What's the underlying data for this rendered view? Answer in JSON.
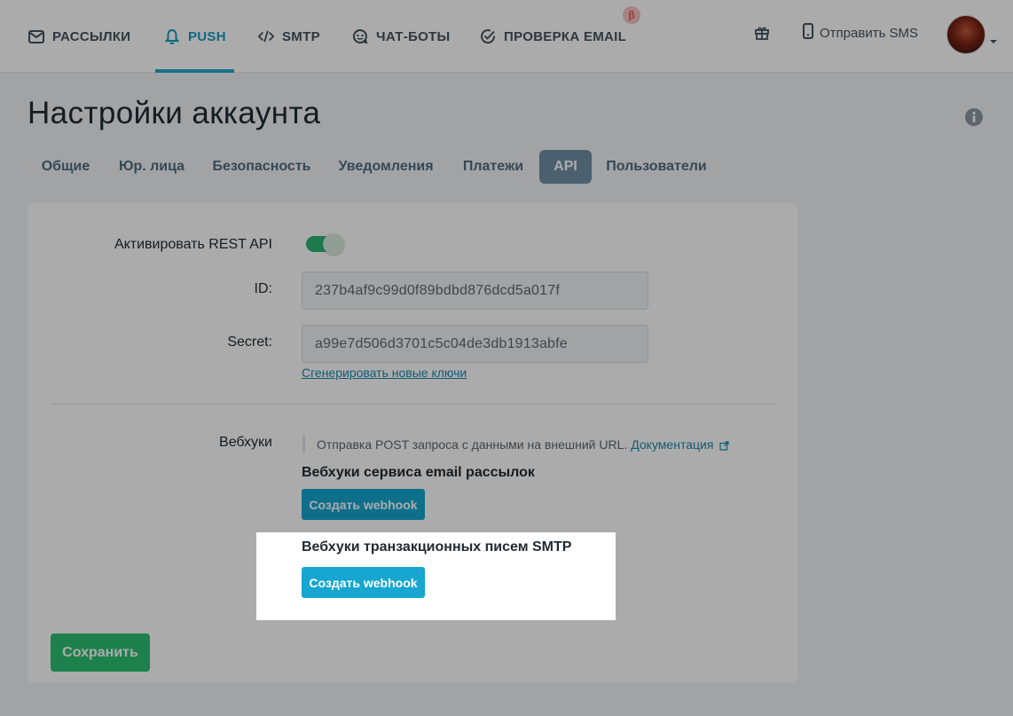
{
  "nav": {
    "items": [
      {
        "label": "Рассылки",
        "icon": "envelope-icon"
      },
      {
        "label": "Push",
        "icon": "bell-icon",
        "active": true
      },
      {
        "label": "SMTP",
        "icon": "code-icon"
      },
      {
        "label": "Чат-боты",
        "icon": "chat-bot-icon"
      },
      {
        "label": "Проверка email",
        "icon": "check-circle-icon"
      }
    ],
    "beta_badge": "β",
    "gift_icon": "gift-icon",
    "sms_label": "Отправить SMS",
    "sms_icon": "phone-icon"
  },
  "page": {
    "title": "Настройки аккаунта",
    "info_icon": "info-icon"
  },
  "tabs": [
    {
      "label": "Общие"
    },
    {
      "label": "Юр. лица"
    },
    {
      "label": "Безопасность"
    },
    {
      "label": "Уведомления"
    },
    {
      "label": "Платежи"
    },
    {
      "label": "API",
      "active": true
    },
    {
      "label": "Пользователи"
    }
  ],
  "api": {
    "rest_label": "Активировать REST API",
    "rest_enabled": true,
    "id_label": "ID:",
    "id_value": "237b4af9c99d0f89bdbd876dcd5a017f",
    "secret_label": "Secret:",
    "secret_value": "a99e7d506d3701c5c04de3db1913abfe",
    "regen_link": "Сгенерировать новые ключи"
  },
  "webhooks": {
    "label": "Вебхуки",
    "hint_text": "Отправка POST запроса с данными на внешний URL.",
    "doc_link": "Документация",
    "email_title": "Вебхуки сервиса email рассылок",
    "email_button": "Создать webhook",
    "smtp_title": "Вебхуки транзакционных писем SMTP",
    "smtp_button": "Создать webhook"
  },
  "save_button": "Сохранить",
  "colors": {
    "accent": "#16a6cf",
    "success": "#2dbf74",
    "active_tab": "#6f8fa6"
  }
}
